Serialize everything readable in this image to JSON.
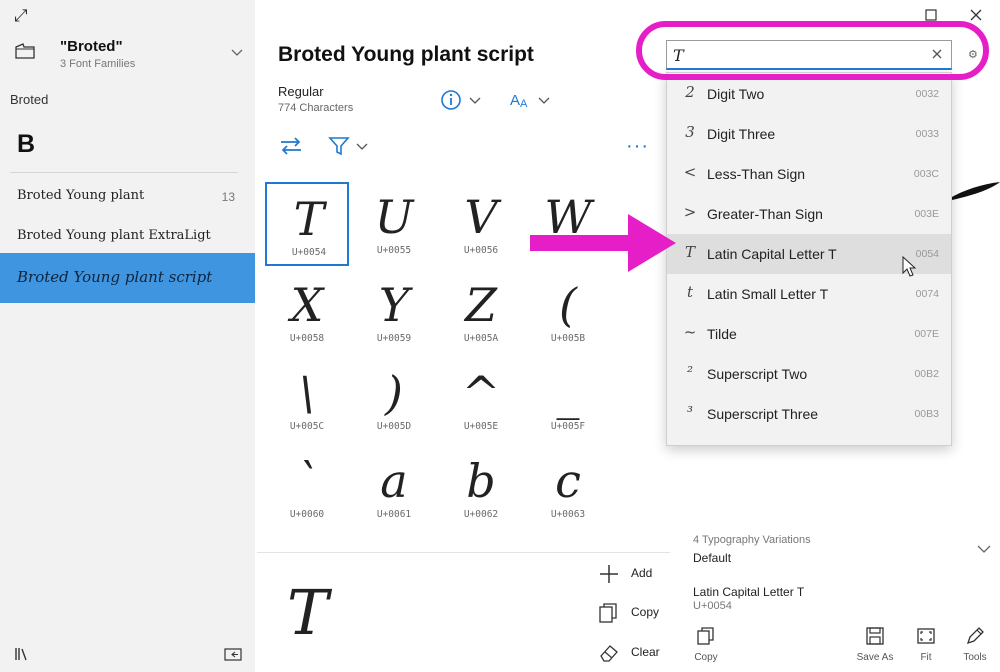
{
  "sidebar": {
    "collection_title": "\"Broted\"",
    "collection_subtitle": "3 Font Families",
    "breadcrumb": "Broted",
    "letter_heading": "B",
    "fonts": [
      {
        "name": "Broted Young plant",
        "count": "13"
      },
      {
        "name": "Broted Young plant ExtraLigt",
        "count": ""
      },
      {
        "name": "Broted Young plant script",
        "count": ""
      }
    ]
  },
  "main": {
    "font_title": "Broted Young plant script",
    "variant": "Regular",
    "character_count": "774 Characters",
    "more_label": "···",
    "grid": [
      {
        "glyph": "T",
        "code": "U+0054"
      },
      {
        "glyph": "U",
        "code": "U+0055"
      },
      {
        "glyph": "V",
        "code": "U+0056"
      },
      {
        "glyph": "W",
        "code": ""
      },
      {
        "glyph": "X",
        "code": "U+0058"
      },
      {
        "glyph": "Y",
        "code": "U+0059"
      },
      {
        "glyph": "Z",
        "code": "U+005A"
      },
      {
        "glyph": "(",
        "code": "U+005B"
      },
      {
        "glyph": "\\",
        "code": "U+005C"
      },
      {
        "glyph": ")",
        "code": "U+005D"
      },
      {
        "glyph": "^",
        "code": "U+005E"
      },
      {
        "glyph": "_",
        "code": "U+005F"
      },
      {
        "glyph": "`",
        "code": "U+0060"
      },
      {
        "glyph": "a",
        "code": "U+0061"
      },
      {
        "glyph": "b",
        "code": "U+0062"
      },
      {
        "glyph": "c",
        "code": "U+0063"
      }
    ],
    "preview_glyph": "T",
    "actions": {
      "add": "Add",
      "copy": "Copy",
      "clear": "Clear"
    }
  },
  "search": {
    "value": "T",
    "results": [
      {
        "glyph": "2",
        "name": "Digit Two",
        "code": "0032"
      },
      {
        "glyph": "3",
        "name": "Digit Three",
        "code": "0033"
      },
      {
        "glyph": "<",
        "name": "Less-Than Sign",
        "code": "003C"
      },
      {
        "glyph": ">",
        "name": "Greater-Than Sign",
        "code": "003E"
      },
      {
        "glyph": "T",
        "name": "Latin Capital Letter T",
        "code": "0054"
      },
      {
        "glyph": "t",
        "name": "Latin Small Letter T",
        "code": "0074"
      },
      {
        "glyph": "~",
        "name": "Tilde",
        "code": "007E"
      },
      {
        "glyph": "²",
        "name": "Superscript Two",
        "code": "00B2"
      },
      {
        "glyph": "³",
        "name": "Superscript Three",
        "code": "00B3"
      }
    ]
  },
  "details": {
    "variations_label": "4 Typography Variations",
    "variations_value": "Default",
    "char_name": "Latin Capital Letter T",
    "char_code": "U+0054",
    "toolbar": {
      "copy": "Copy",
      "save_as": "Save As",
      "fit": "Fit",
      "tools": "Tools"
    }
  },
  "colors": {
    "accent": "#1f78d1",
    "selection": "#3f95e0",
    "annotation": "#e61ec8"
  }
}
